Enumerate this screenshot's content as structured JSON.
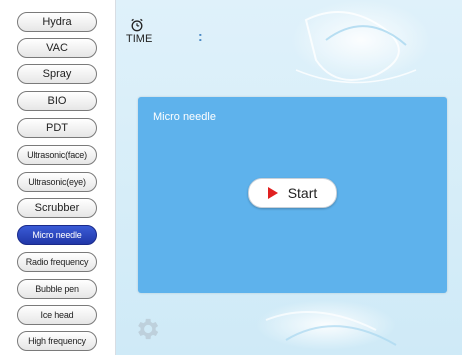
{
  "sidebar": {
    "items": [
      {
        "label": "Hydra"
      },
      {
        "label": "VAC"
      },
      {
        "label": "Spray"
      },
      {
        "label": "BIO"
      },
      {
        "label": "PDT"
      },
      {
        "label": "Ultrasonic(face)"
      },
      {
        "label": "Ultrasonic(eye)"
      },
      {
        "label": "Scrubber"
      },
      {
        "label": "Micro needle",
        "active": true
      },
      {
        "label": "Radio frequency"
      },
      {
        "label": "Bubble pen"
      },
      {
        "label": "Ice head"
      },
      {
        "label": "High frequency"
      }
    ]
  },
  "timer": {
    "label": "TIME",
    "value": ":",
    "icon": "alarm-clock-icon"
  },
  "panel": {
    "title": "Micro needle",
    "start_label": "Start",
    "start_icon": "play-icon"
  },
  "settings": {
    "icon": "gear-icon"
  },
  "colors": {
    "panel": "#5eb2ec",
    "active_item": "#2b45c0",
    "play": "#e02020",
    "time_value": "#4a88c4"
  }
}
